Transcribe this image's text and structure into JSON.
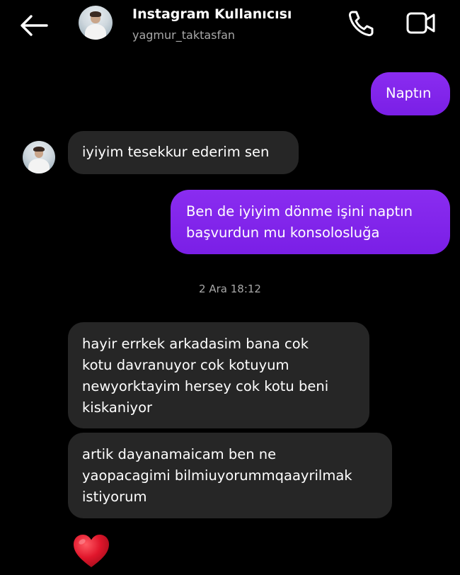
{
  "header": {
    "back_icon": "arrow-left-icon",
    "contact_name": "Instagram Kullanıcısı",
    "contact_handle": "yagmur_taktasfan",
    "call_icon": "phone-icon",
    "video_icon": "video-camera-icon"
  },
  "messages": [
    {
      "direction": "outgoing",
      "lines": [
        "Naptın"
      ]
    },
    {
      "direction": "incoming",
      "lines": [
        "iyiyim tesekkur ederim sen"
      ]
    },
    {
      "direction": "outgoing",
      "lines": [
        "Ben de iyiyim dönme işini naptın",
        "başvurdun mu konsolosluğa"
      ]
    },
    {
      "direction": "incoming",
      "lines": [
        "hayir errkek arkadasim bana cok",
        "kotu davranuyor cok kotuyum",
        "newyorktayim hersey cok kotu beni",
        "kiskaniyor"
      ]
    },
    {
      "direction": "incoming",
      "lines": [
        "artik dayanamaicam ben ne",
        "yaopacagimi bilmiuyorummqaayrilmak",
        "istiyorum"
      ]
    }
  ],
  "timestamp": "2 Ara 18:12",
  "reaction": {
    "emoji": "red-heart-icon",
    "color": "#e0162b"
  },
  "colors": {
    "background": "#000000",
    "outgoing_bubble": "#8a2cf0",
    "incoming_bubble": "#262626",
    "secondary_text": "#a8a8a8"
  }
}
